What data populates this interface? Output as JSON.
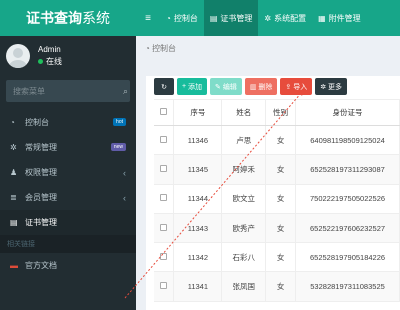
{
  "app": {
    "title_bold": "证书查询",
    "title_light": "系统"
  },
  "topnav": {
    "toggle_icon": "hamburger-icon",
    "items": [
      {
        "label": "控制台",
        "icon": "dashboard-icon",
        "active": false
      },
      {
        "label": "证书管理",
        "icon": "id-card-icon",
        "active": true
      },
      {
        "label": "系统配置",
        "icon": "gears-icon",
        "active": false
      },
      {
        "label": "附件管理",
        "icon": "file-icon",
        "active": false
      }
    ]
  },
  "user": {
    "name": "Admin",
    "status": "在线",
    "status_color": "#1fbf5c"
  },
  "search": {
    "placeholder": "搜索菜单"
  },
  "sidebar": {
    "items": [
      {
        "label": "控制台",
        "icon": "dashboard-icon",
        "badge": "hot",
        "badge_color": "#0073b7"
      },
      {
        "label": "常规管理",
        "icon": "cogs-icon",
        "badge": "new",
        "badge_color": "#605ca8"
      },
      {
        "label": "权限管理",
        "icon": "group-icon",
        "chevron": "‹"
      },
      {
        "label": "会员管理",
        "icon": "list-icon",
        "chevron": "‹"
      },
      {
        "label": "证书管理",
        "icon": "id-card-icon",
        "active": true
      }
    ],
    "section": "相关链接",
    "links": [
      {
        "label": "官方文档",
        "icon": "doc-icon"
      }
    ]
  },
  "breadcrumb": {
    "label": "控制台",
    "icon": "dashboard-icon"
  },
  "toolbar": {
    "refresh_icon": "refresh-icon",
    "add": "添加",
    "edit": "编辑",
    "delete": "删除",
    "import": "导入",
    "more": "更多"
  },
  "table": {
    "columns": [
      "",
      "序号",
      "姓名",
      "性别",
      "身份证号"
    ],
    "rows": [
      {
        "id": "11346",
        "name": "卢思",
        "gender": "女",
        "idno": "640981198509125024"
      },
      {
        "id": "11345",
        "name": "阿婷禾",
        "gender": "女",
        "idno": "652528197311293087"
      },
      {
        "id": "11344",
        "name": "欧文立",
        "gender": "女",
        "idno": "750222197505022526"
      },
      {
        "id": "11343",
        "name": "欧秀产",
        "gender": "女",
        "idno": "652522197606232527"
      },
      {
        "id": "11342",
        "name": "石彩八",
        "gender": "女",
        "idno": "652528197905184226"
      },
      {
        "id": "11341",
        "name": "张凤国",
        "gender": "女",
        "idno": "532828197311083525"
      }
    ]
  },
  "colors": {
    "brand": "#17a689",
    "sidebar_bg": "#222d32",
    "import_btn": "#e74c3c"
  }
}
